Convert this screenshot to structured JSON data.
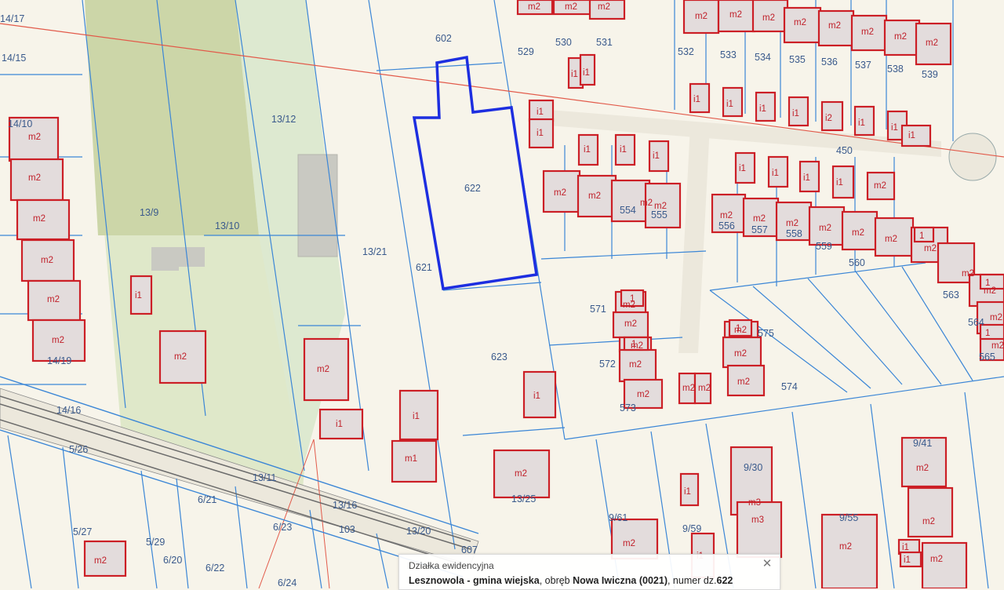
{
  "colors": {
    "background": "#f7f4ea",
    "parcel_line": "#3b86d6",
    "building": "#cc1f26",
    "building_fill": "#e3dcdc",
    "selected_parcel": "#1d2ee0",
    "green_area": "#dbe9c8",
    "green_area_dark": "#cbd7a9",
    "road": "#e9e6dc"
  },
  "parcels": [
    {
      "id": "p-14-17",
      "text": "14/17"
    },
    {
      "id": "p-14-15",
      "text": "14/15"
    },
    {
      "id": "p-14-10",
      "text": "14/10"
    },
    {
      "id": "p-14-19",
      "text": "14/19"
    },
    {
      "id": "p-14-16",
      "text": "14/16"
    },
    {
      "id": "p-5-26",
      "text": "5/26"
    },
    {
      "id": "p-5-27",
      "text": "5/27"
    },
    {
      "id": "p-5-29",
      "text": "5/29"
    },
    {
      "id": "p-6-20",
      "text": "6/20"
    },
    {
      "id": "p-6-21",
      "text": "6/21"
    },
    {
      "id": "p-6-22",
      "text": "6/22"
    },
    {
      "id": "p-6-23",
      "text": "6/23"
    },
    {
      "id": "p-6-24",
      "text": "6/24"
    },
    {
      "id": "p-13-9",
      "text": "13/9"
    },
    {
      "id": "p-13-10",
      "text": "13/10"
    },
    {
      "id": "p-13-12",
      "text": "13/12"
    },
    {
      "id": "p-13-21",
      "text": "13/21"
    },
    {
      "id": "p-13-11",
      "text": "13/11"
    },
    {
      "id": "p-13-16",
      "text": "13/16"
    },
    {
      "id": "p-103",
      "text": "103"
    },
    {
      "id": "p-13-20",
      "text": "13/20"
    },
    {
      "id": "p-13-25",
      "text": "13/25"
    },
    {
      "id": "p-602",
      "text": "602"
    },
    {
      "id": "p-621",
      "text": "621"
    },
    {
      "id": "p-622",
      "text": "622"
    },
    {
      "id": "p-623",
      "text": "623"
    },
    {
      "id": "p-607",
      "text": "607"
    },
    {
      "id": "p-529",
      "text": "529"
    },
    {
      "id": "p-530",
      "text": "530"
    },
    {
      "id": "p-531",
      "text": "531"
    },
    {
      "id": "p-532",
      "text": "532"
    },
    {
      "id": "p-533",
      "text": "533"
    },
    {
      "id": "p-534",
      "text": "534"
    },
    {
      "id": "p-535",
      "text": "535"
    },
    {
      "id": "p-536",
      "text": "536"
    },
    {
      "id": "p-537",
      "text": "537"
    },
    {
      "id": "p-538",
      "text": "538"
    },
    {
      "id": "p-539",
      "text": "539"
    },
    {
      "id": "p-450",
      "text": "450"
    },
    {
      "id": "p-554",
      "text": "554"
    },
    {
      "id": "p-555",
      "text": "555"
    },
    {
      "id": "p-556",
      "text": "556"
    },
    {
      "id": "p-557",
      "text": "557"
    },
    {
      "id": "p-558",
      "text": "558"
    },
    {
      "id": "p-559",
      "text": "559"
    },
    {
      "id": "p-560",
      "text": "560"
    },
    {
      "id": "p-563",
      "text": "563"
    },
    {
      "id": "p-564",
      "text": "564"
    },
    {
      "id": "p-565",
      "text": "565"
    },
    {
      "id": "p-571",
      "text": "571"
    },
    {
      "id": "p-572",
      "text": "572"
    },
    {
      "id": "p-573",
      "text": "573"
    },
    {
      "id": "p-574",
      "text": "574"
    },
    {
      "id": "p-575",
      "text": "575"
    },
    {
      "id": "p-9-30",
      "text": "9/30"
    },
    {
      "id": "p-9-41",
      "text": "9/41"
    },
    {
      "id": "p-9-55",
      "text": "9/55"
    },
    {
      "id": "p-9-59",
      "text": "9/59"
    },
    {
      "id": "p-9-61",
      "text": "9/61"
    }
  ],
  "buildings": [
    {
      "id": "b-m2-a",
      "text": "m2"
    },
    {
      "id": "b-m2-b",
      "text": "m2"
    },
    {
      "id": "b-m2-c",
      "text": "m2"
    },
    {
      "id": "b-m2-d",
      "text": "m2"
    },
    {
      "id": "b-m2-e",
      "text": "m2"
    },
    {
      "id": "b-m2-f",
      "text": "m2"
    },
    {
      "id": "b-i1-a",
      "text": "i1"
    },
    {
      "id": "b-m2-g",
      "text": "m2"
    },
    {
      "id": "b-m2-h",
      "text": "m2"
    },
    {
      "id": "b-i1-b",
      "text": "i1"
    },
    {
      "id": "b-i1-c",
      "text": "i1"
    },
    {
      "id": "b-m1",
      "text": "m1"
    },
    {
      "id": "b-m2-i",
      "text": "m2"
    },
    {
      "id": "b-i1-d",
      "text": "i1"
    },
    {
      "id": "b-i1-e",
      "text": "i1"
    },
    {
      "id": "b-i1-f",
      "text": "i1"
    },
    {
      "id": "b-i1-g",
      "text": "i1"
    },
    {
      "id": "b-i1-h",
      "text": "i1"
    },
    {
      "id": "b-i1-i",
      "text": "i1"
    },
    {
      "id": "b-i1-j",
      "text": "i1"
    },
    {
      "id": "b-m2-j",
      "text": "m2"
    },
    {
      "id": "b-m2-k",
      "text": "m2"
    },
    {
      "id": "b-m2-l",
      "text": "m2"
    },
    {
      "id": "b-m2-m",
      "text": "m2"
    },
    {
      "id": "b-m2-top1",
      "text": "m2"
    },
    {
      "id": "b-m2-top2",
      "text": "m2"
    },
    {
      "id": "b-m2-top3",
      "text": "m2"
    },
    {
      "id": "b-m2-r1",
      "text": "m2"
    },
    {
      "id": "b-m2-r2",
      "text": "m2"
    },
    {
      "id": "b-m2-r3",
      "text": "m2"
    },
    {
      "id": "b-m2-r4",
      "text": "m2"
    },
    {
      "id": "b-m2-r5",
      "text": "m2"
    },
    {
      "id": "b-m2-r6",
      "text": "m2"
    },
    {
      "id": "b-m2-r7",
      "text": "m2"
    },
    {
      "id": "b-m2-r8",
      "text": "m2"
    },
    {
      "id": "b-i1-r1",
      "text": "i1"
    },
    {
      "id": "b-i1-r2",
      "text": "i1"
    },
    {
      "id": "b-i1-r3",
      "text": "i1"
    },
    {
      "id": "b-i1-r4",
      "text": "i1"
    },
    {
      "id": "b-i2-r5",
      "text": "i2"
    },
    {
      "id": "b-i1-r6",
      "text": "i1"
    },
    {
      "id": "b-i1-r7",
      "text": "i1"
    },
    {
      "id": "b-i1-r8",
      "text": "i1"
    },
    {
      "id": "b-i1-r9",
      "text": "i1"
    },
    {
      "id": "b-i1-r10",
      "text": "i1"
    },
    {
      "id": "b-i1-r11",
      "text": "i1"
    },
    {
      "id": "b-i1-r12",
      "text": "i1"
    },
    {
      "id": "b-i1-r13",
      "text": "i1"
    },
    {
      "id": "b-m2-s1",
      "text": "m2"
    },
    {
      "id": "b-m2-s2",
      "text": "m2"
    },
    {
      "id": "b-m2-s3",
      "text": "m2"
    },
    {
      "id": "b-m2-s4",
      "text": "m2"
    },
    {
      "id": "b-m2-s5",
      "text": "m2"
    },
    {
      "id": "b-m2-s6",
      "text": "m2"
    },
    {
      "id": "b-m2-s7",
      "text": "m2"
    },
    {
      "id": "b-m2-s8",
      "text": "m2"
    },
    {
      "id": "b-m2-s9",
      "text": "m2"
    },
    {
      "id": "b-m2-s10",
      "text": "m2"
    },
    {
      "id": "b-m2-s11",
      "text": "m2"
    },
    {
      "id": "b-m2-s12",
      "text": "m2"
    },
    {
      "id": "b-m2-c1",
      "text": "m2"
    },
    {
      "id": "b-m2-c2",
      "text": "m2"
    },
    {
      "id": "b-m2-c3",
      "text": "m2"
    },
    {
      "id": "b-m2-c4",
      "text": "m2"
    },
    {
      "id": "b-m2-c5",
      "text": "m2"
    },
    {
      "id": "b-m2-c6",
      "text": "m2"
    },
    {
      "id": "b-m2-c7",
      "text": "m2"
    },
    {
      "id": "b-m2-c8",
      "text": "m2"
    },
    {
      "id": "b-m2-c9",
      "text": "m2"
    },
    {
      "id": "b-m2-c10",
      "text": "m2"
    },
    {
      "id": "b-m3-a",
      "text": "m3"
    },
    {
      "id": "b-m3-b",
      "text": "m3"
    },
    {
      "id": "b-m2-bot1",
      "text": "m2"
    },
    {
      "id": "b-m2-bot2",
      "text": "m2"
    },
    {
      "id": "b-m2-bot3",
      "text": "m2"
    },
    {
      "id": "b-m2-bot4",
      "text": "m2"
    },
    {
      "id": "b-m2-bot5",
      "text": "m2"
    },
    {
      "id": "b-m2-bot6",
      "text": "m2"
    },
    {
      "id": "b-i1-bot1",
      "text": "i1"
    },
    {
      "id": "b-i1-bot2",
      "text": "i1"
    },
    {
      "id": "b-i1-bot3",
      "text": "i1"
    },
    {
      "id": "b-i1-bot4",
      "text": "i1"
    },
    {
      "id": "b-1-a",
      "text": "1"
    },
    {
      "id": "b-1-b",
      "text": "1"
    },
    {
      "id": "b-1-c",
      "text": "1"
    },
    {
      "id": "b-1-d",
      "text": "1"
    },
    {
      "id": "b-1-e",
      "text": "1"
    },
    {
      "id": "b-1-f",
      "text": "1"
    },
    {
      "id": "b-m2-bigc",
      "text": "m2"
    }
  ],
  "popup": {
    "title": "Działka ewidencyjna",
    "gmina": "Lesznowola - gmina wiejska",
    "sep1": ", obręb ",
    "obreb": "Nowa Iwiczna (0021)",
    "sep2": ", numer dz.",
    "numer": "622",
    "close_icon": "close-icon"
  }
}
